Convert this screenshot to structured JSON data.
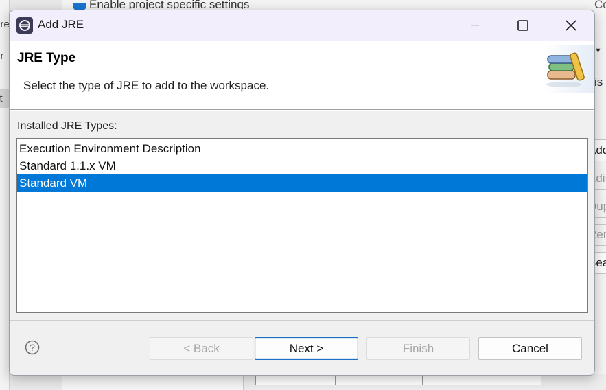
{
  "window": {
    "title": "Add JRE",
    "minimize_icon": "minimize-icon",
    "maximize_icon": "maximize-icon",
    "close_icon": "close-icon"
  },
  "header": {
    "title": "JRE Type",
    "description": "Select the type of JRE to add to the workspace.",
    "image_icon": "books-icon"
  },
  "list": {
    "label": "Installed JRE Types:",
    "items": [
      "Execution Environment Description",
      "Standard 1.1.x VM",
      "Standard VM"
    ],
    "selected_index": 2
  },
  "buttons": {
    "help_icon": "help-icon",
    "back": "< Back",
    "next": "Next >",
    "finish": "Finish",
    "cancel": "Cancel"
  },
  "background": {
    "top_text": "Enable project specific settings",
    "top_right": "Co",
    "left_fragments": [
      "ere",
      "er",
      "st"
    ],
    "right_is": "is",
    "right_buttons": [
      "Add...",
      "Edit...",
      "Duplicate...",
      "Remove",
      "Search..."
    ]
  },
  "colors": {
    "selection": "#0078d7",
    "accent": "#1f6fc5",
    "titlebar": "#f3eefb"
  }
}
